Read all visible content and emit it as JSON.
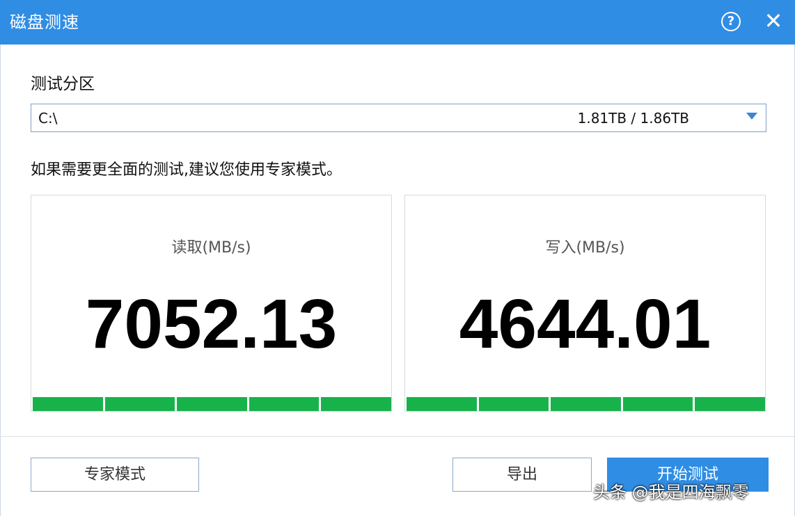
{
  "window": {
    "title": "磁盘测速",
    "help_icon": "?",
    "close_icon": "✕",
    "accent": "#2f8de4"
  },
  "partition": {
    "label": "测试分区",
    "drive": "C:\\",
    "size": "1.81TB / 1.86TB"
  },
  "hint": "如果需要更全面的测试,建议您使用专家模式。",
  "results": {
    "read": {
      "label": "读取(MB/s)",
      "value": "7052.13",
      "progress": 1.0
    },
    "write": {
      "label": "写入(MB/s)",
      "value": "4644.01",
      "progress": 1.0
    }
  },
  "buttons": {
    "expert": "专家模式",
    "export": "导出",
    "start": "开始测试"
  },
  "watermark": "头条 @我是四海飘零",
  "colors": {
    "progress": "#17b34a",
    "primary": "#2f8de4"
  }
}
